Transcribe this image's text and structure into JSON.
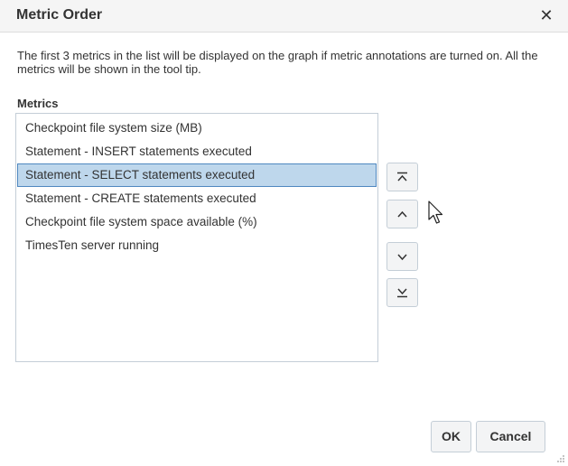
{
  "dialog": {
    "title": "Metric Order",
    "close_label": "✕",
    "description": "The first 3 metrics in the list will be displayed on the graph if metric annotations are turned on. All the metrics will be shown in the tool tip.",
    "metrics_label": "Metrics",
    "metrics": [
      "Checkpoint file system size (MB)",
      "Statement - INSERT statements executed",
      "Statement - SELECT statements executed",
      "Statement - CREATE statements executed",
      "Checkpoint file system space available (%)",
      "TimesTen server running"
    ],
    "selected_metric": "Statement - SELECT statements executed",
    "reorder_buttons": {
      "top_icon": "move-to-top-icon",
      "up_icon": "move-up-icon",
      "down_icon": "move-down-icon",
      "bottom_icon": "move-to-bottom-icon"
    },
    "ok_label": "OK",
    "cancel_label": "Cancel"
  },
  "colors": {
    "selection_bg": "#bed7ec",
    "selection_border": "#4f88c0",
    "border": "#c4ced7",
    "button_bg": "#f3f4f5"
  }
}
